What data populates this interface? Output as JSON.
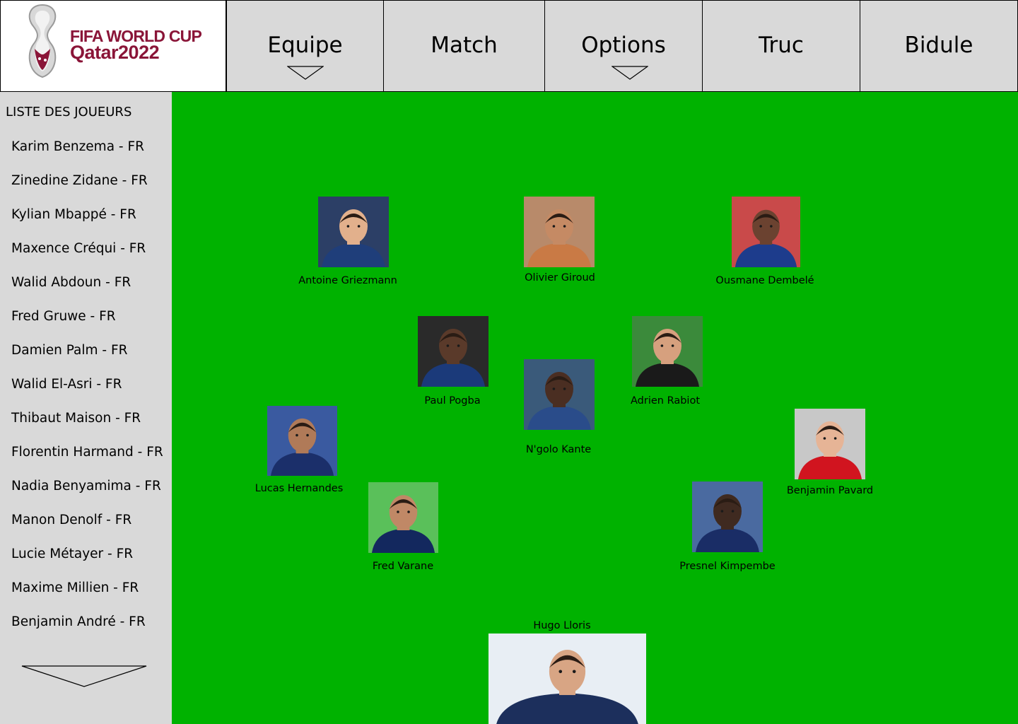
{
  "logo": {
    "line1": "FIFA WORLD CUP",
    "line2": "Qatar2022"
  },
  "nav": {
    "tabs": [
      {
        "label": "Equipe",
        "has_dropdown": true
      },
      {
        "label": "Match",
        "has_dropdown": false
      },
      {
        "label": "Options",
        "has_dropdown": true
      },
      {
        "label": "Truc",
        "has_dropdown": false
      },
      {
        "label": "Bidule",
        "has_dropdown": false
      }
    ]
  },
  "sidebar": {
    "title": "LISTE DES JOUEURS",
    "players": [
      "Karim Benzema - FR",
      "Zinedine Zidane - FR",
      "Kylian Mbappé - FR",
      "Maxence Créqui - FR",
      "Walid Abdoun - FR",
      "Fred Gruwe - FR",
      "Damien Palm - FR",
      "Walid El-Asri - FR",
      "Thibaut Maison - FR",
      "Florentin Harmand - FR",
      "Nadia Benyamima - FR",
      "Manon Denolf - FR",
      "Lucie Métayer - FR",
      "Maxime Millien - FR",
      "Benjamin André - FR"
    ]
  },
  "field": {
    "color": "#00b200",
    "lineup": [
      {
        "name": "Antoine Griezmann",
        "jersey": "#1f3e7a"
      },
      {
        "name": "Olivier Giroud",
        "jersey": "#c97a45"
      },
      {
        "name": "Ousmane Dembelé",
        "jersey": "#1d3c8c"
      },
      {
        "name": "Paul Pogba",
        "jersey": "#1b3a7a"
      },
      {
        "name": "N'golo Kante",
        "jersey": "#2a4c8a"
      },
      {
        "name": "Adrien Rabiot",
        "jersey": "#1a1a1a"
      },
      {
        "name": "Lucas Hernandes",
        "jersey": "#1b2f6a"
      },
      {
        "name": "Benjamin Pavard",
        "jersey": "#d1141f"
      },
      {
        "name": "Fred Varane",
        "jersey": "#13285e"
      },
      {
        "name": "Presnel Kimpembe",
        "jersey": "#1a2d66"
      },
      {
        "name": "Hugo Lloris",
        "jersey": "#1c2f5c"
      }
    ]
  },
  "colors": {
    "header_bg": "#d9d9d9",
    "sidebar_bg": "#d9d9d9",
    "brand": "#8a1538"
  }
}
